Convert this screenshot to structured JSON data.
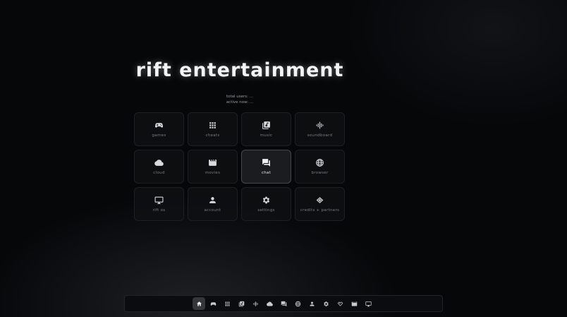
{
  "title": "rift entertainment",
  "stats": {
    "total_users": "total users: ...",
    "active_now": "active now: ..."
  },
  "tiles": [
    {
      "label": "games",
      "icon": "gamepad-icon"
    },
    {
      "label": "cheats",
      "icon": "grid-icon"
    },
    {
      "label": "music",
      "icon": "music-library-icon"
    },
    {
      "label": "soundboard",
      "icon": "waveform-icon"
    },
    {
      "label": "cloud",
      "icon": "cloud-icon"
    },
    {
      "label": "movies",
      "icon": "clapperboard-icon"
    },
    {
      "label": "chat",
      "icon": "chat-icon",
      "active": true
    },
    {
      "label": "browser",
      "icon": "globe-icon"
    },
    {
      "label": "rift os",
      "icon": "monitor-icon"
    },
    {
      "label": "account",
      "icon": "person-icon"
    },
    {
      "label": "settings",
      "icon": "gear-icon"
    },
    {
      "label": "credits + partners",
      "icon": "handshake-icon"
    }
  ],
  "dock": [
    {
      "icon": "home-icon",
      "active": true
    },
    {
      "icon": "gamepad-icon"
    },
    {
      "icon": "grid-icon"
    },
    {
      "icon": "music-library-icon"
    },
    {
      "icon": "waveform-icon"
    },
    {
      "icon": "cloud-icon"
    },
    {
      "icon": "chat-icon"
    },
    {
      "icon": "globe-icon"
    },
    {
      "icon": "person-icon"
    },
    {
      "icon": "gear-icon"
    },
    {
      "icon": "handshake-icon"
    },
    {
      "icon": "clapperboard-icon"
    },
    {
      "icon": "monitor-icon"
    }
  ],
  "colors": {
    "background": "#060709",
    "tile_background": "#0e0f12",
    "tile_border": "#1d1f24",
    "active_tile_background": "#1b1c20",
    "active_tile_border": "#46484e",
    "label": "#7b7d84",
    "icon": "#d8d9dc",
    "title": "#f4f4f4"
  }
}
